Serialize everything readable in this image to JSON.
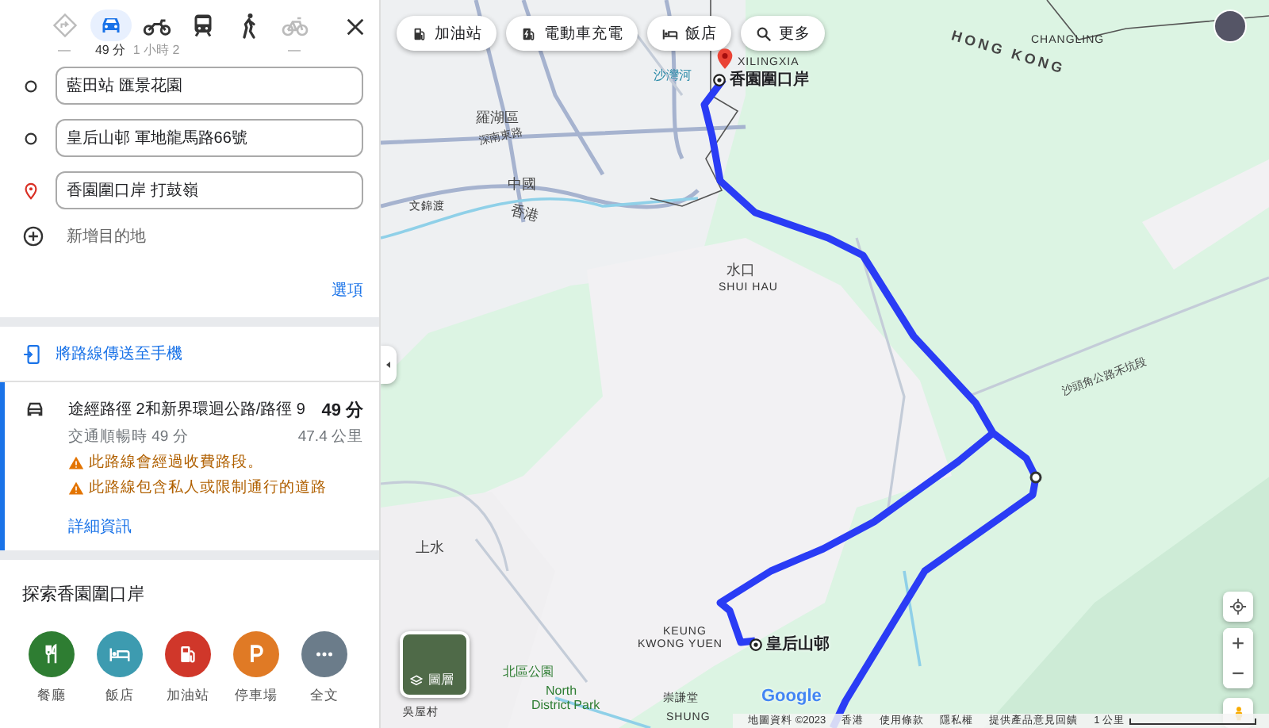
{
  "travel_modes": [
    {
      "kind": "best",
      "time": "—",
      "selected": false
    },
    {
      "kind": "car",
      "time": "49 分",
      "selected": true
    },
    {
      "kind": "motorcycle",
      "time": "1 小時 2",
      "selected": false
    },
    {
      "kind": "transit",
      "selected": false
    },
    {
      "kind": "walk",
      "selected": false
    },
    {
      "kind": "bike",
      "time": "—",
      "selected": false
    }
  ],
  "waypoints": [
    {
      "kind": "origin",
      "value": "藍田站 匯景花園"
    },
    {
      "kind": "stop",
      "value": "皇后山邨 軍地龍馬路66號"
    },
    {
      "kind": "destination",
      "value": "香園圍口岸 打鼓嶺"
    }
  ],
  "add_destination": "新增目的地",
  "options_link": "選項",
  "send_to_phone": "將路線傳送至手機",
  "route": {
    "selected": true,
    "title": "途經路徑 2和新界環迴公路/路徑 9",
    "duration": "49 分",
    "traffic_note": "交通順暢時 49 分",
    "distance": "47.4 公里",
    "warnings": [
      "此路線會經過收費路段。",
      "此路線包含私人或限制通行的道路"
    ],
    "details_link": "詳細資訊"
  },
  "explore": {
    "title": "探索香園圍口岸",
    "categories": [
      {
        "kind": "restaurant",
        "label": "餐廳",
        "color": "#2e7d32"
      },
      {
        "kind": "hotel",
        "label": "飯店",
        "color": "#3d9bb0"
      },
      {
        "kind": "gas",
        "label": "加油站",
        "color": "#d0372a"
      },
      {
        "kind": "parking",
        "label": "停車場",
        "color": "#e07a25"
      },
      {
        "kind": "more",
        "label": "全文",
        "color": "#6b7c8a"
      }
    ]
  },
  "map": {
    "chips": [
      {
        "kind": "gas",
        "label": "加油站"
      },
      {
        "kind": "ev",
        "label": "電動車充電"
      },
      {
        "kind": "hotel",
        "label": "飯店"
      },
      {
        "kind": "search",
        "label": "更多"
      }
    ],
    "labels": [
      {
        "kind": "region",
        "text": "HONG KONG"
      },
      {
        "kind": "small",
        "text": "CHANGLING"
      },
      {
        "kind": "small",
        "text": "XILINGXIA"
      },
      {
        "kind": "area",
        "text": "羅湖區"
      },
      {
        "kind": "road",
        "text": "深南東路"
      },
      {
        "kind": "area",
        "text": "中國"
      },
      {
        "kind": "area",
        "text": "香港"
      },
      {
        "kind": "water",
        "text": "沙灣河"
      },
      {
        "kind": "small",
        "text": "文錦渡"
      },
      {
        "kind": "area",
        "text": "水口"
      },
      {
        "kind": "small",
        "text": "SHUI HAU"
      },
      {
        "kind": "area",
        "text": "上水"
      },
      {
        "kind": "small",
        "text": "KEUNG"
      },
      {
        "kind": "small",
        "text": "KWONG YUEN"
      },
      {
        "kind": "park",
        "text": "北區公園"
      },
      {
        "kind": "park",
        "text": "North"
      },
      {
        "kind": "park",
        "text": "District Park"
      },
      {
        "kind": "small",
        "text": "崇謙堂"
      },
      {
        "kind": "small",
        "text": "SHUNG"
      },
      {
        "kind": "small",
        "text": "吳屋村"
      },
      {
        "kind": "road",
        "text": "沙頭角公路禾坑段"
      }
    ],
    "markers": [
      {
        "kind": "destination",
        "label": "香園圍口岸"
      },
      {
        "kind": "stop",
        "label": "皇后山邨"
      }
    ],
    "layers_label": "圖層",
    "logo": "Google",
    "footer": [
      "地圖資料 ©2023",
      "香港",
      "使用條款",
      "隱私權",
      "提供產品意見回饋"
    ],
    "scale": "1 公里"
  }
}
